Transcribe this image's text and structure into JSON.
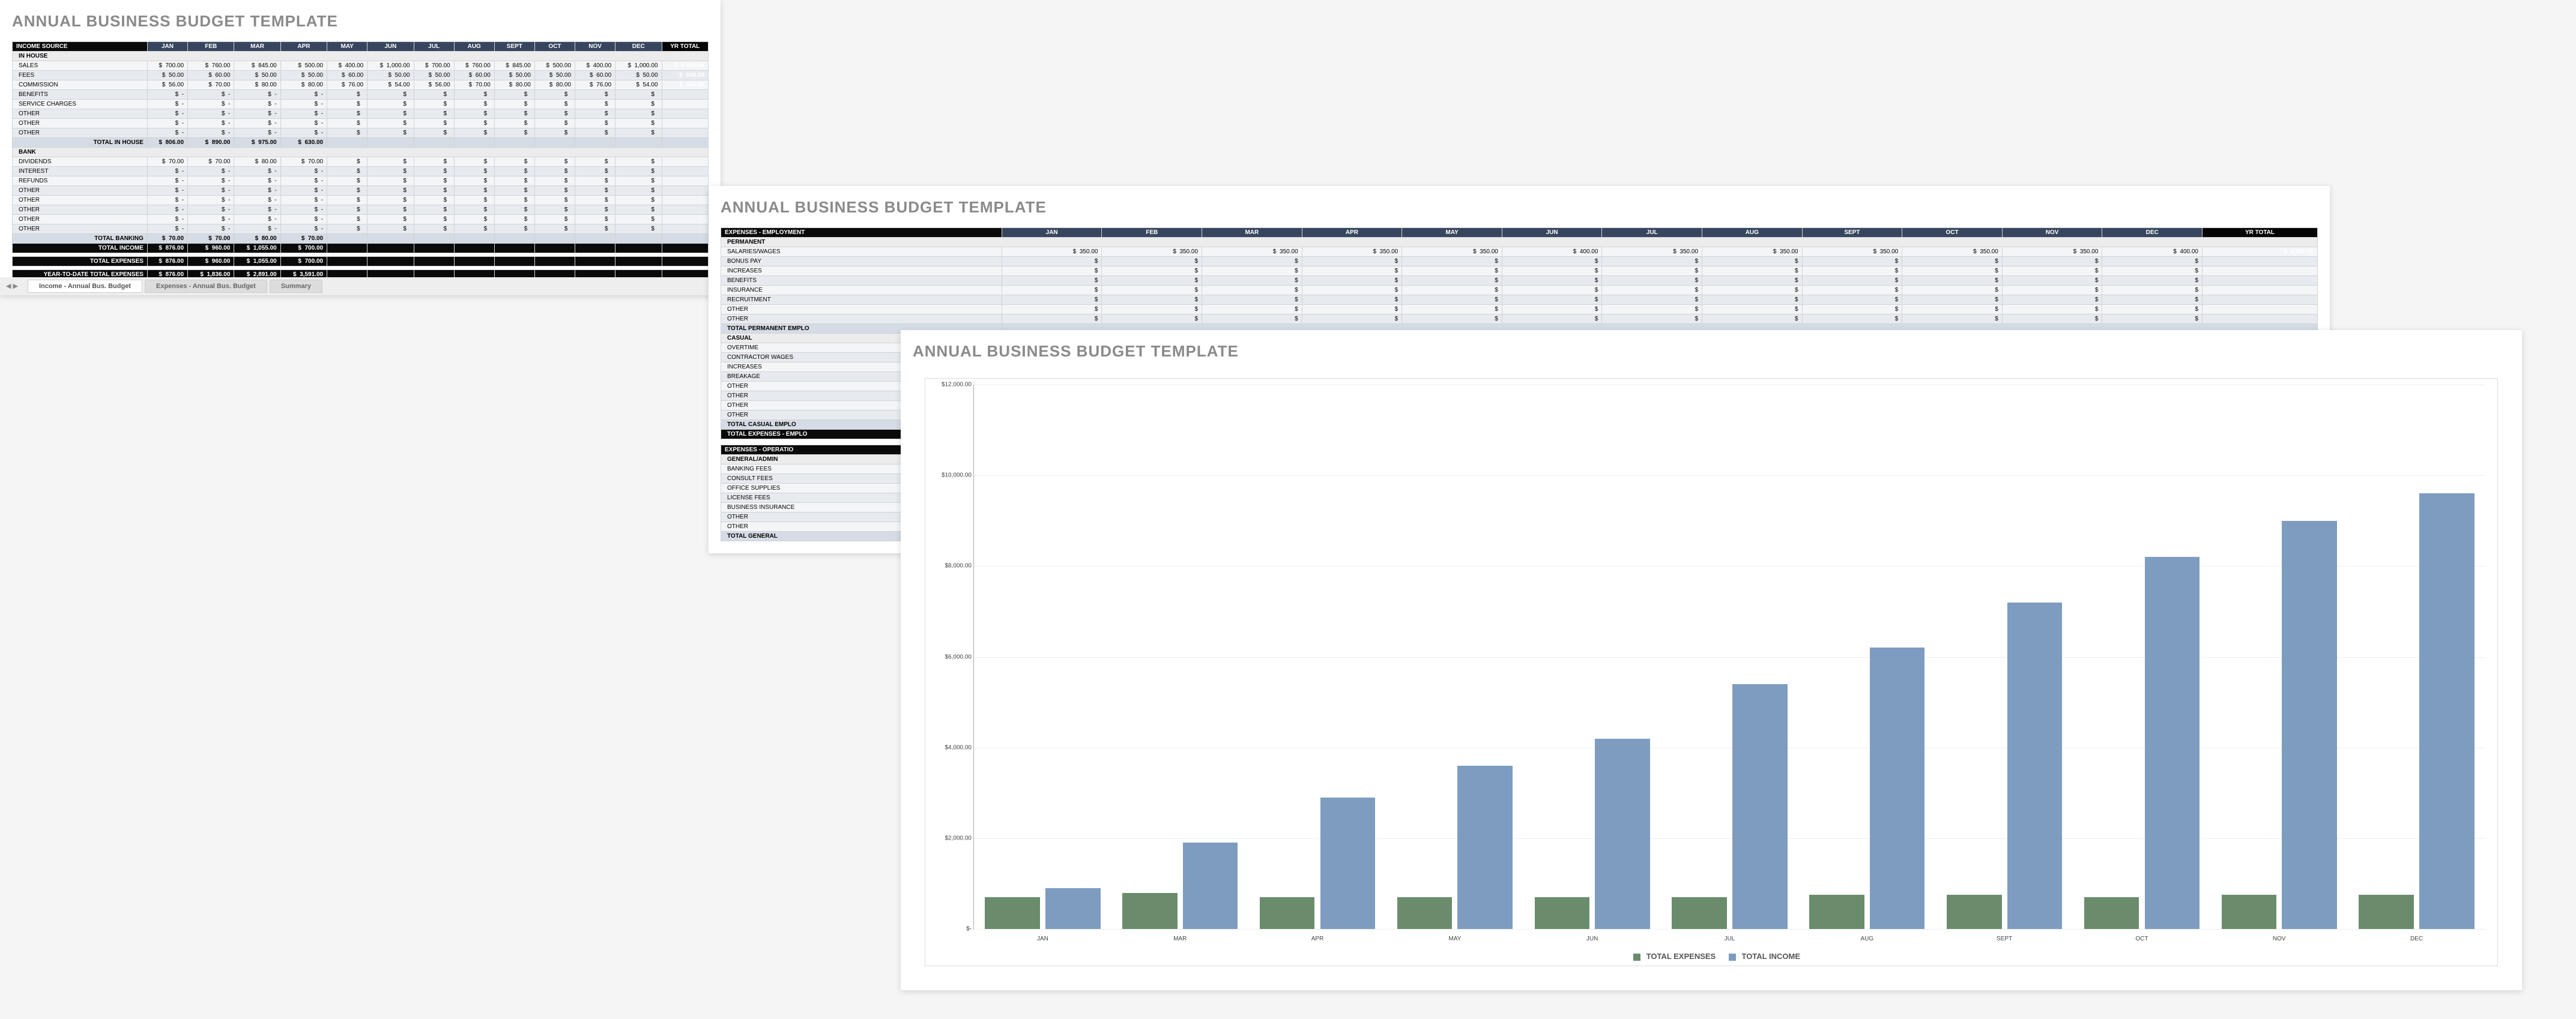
{
  "app_title": "ANNUAL BUSINESS BUDGET TEMPLATE",
  "months": [
    "JAN",
    "FEB",
    "MAR",
    "APR",
    "MAY",
    "JUN",
    "JUL",
    "AUG",
    "SEPT",
    "OCT",
    "NOV",
    "DEC"
  ],
  "yr_total_label": "YR TOTAL",
  "income_sheet": {
    "header_label": "INCOME SOURCE",
    "sections": [
      {
        "name": "IN HOUSE",
        "rows": [
          {
            "label": "SALES",
            "vals": [
              "700.00",
              "760.00",
              "845.00",
              "500.00",
              "400.00",
              "1,000.00",
              "700.00",
              "760.00",
              "845.00",
              "500.00",
              "400.00",
              "1,000.00"
            ],
            "yt": "8,410.00"
          },
          {
            "label": "FEES",
            "vals": [
              "50.00",
              "60.00",
              "50.00",
              "50.00",
              "60.00",
              "50.00",
              "50.00",
              "60.00",
              "50.00",
              "50.00",
              "60.00",
              "50.00"
            ],
            "yt": "640.00"
          },
          {
            "label": "COMMISSION",
            "vals": [
              "56.00",
              "70.00",
              "80.00",
              "80.00",
              "76.00",
              "54.00",
              "56.00",
              "70.00",
              "80.00",
              "80.00",
              "76.00",
              "54.00"
            ],
            "yt": "832.00"
          },
          {
            "label": "BENEFITS",
            "vals": [
              "-",
              "-",
              "-",
              "-"
            ],
            "yt": ""
          },
          {
            "label": "SERVICE CHARGES",
            "vals": [
              "-",
              "-",
              "-",
              "-"
            ],
            "yt": ""
          },
          {
            "label": "OTHER",
            "vals": [
              "-",
              "-",
              "-",
              "-"
            ],
            "yt": ""
          },
          {
            "label": "OTHER",
            "vals": [
              "-",
              "-",
              "-",
              "-"
            ],
            "yt": ""
          },
          {
            "label": "OTHER",
            "vals": [
              "-",
              "-",
              "-",
              "-"
            ],
            "yt": ""
          }
        ],
        "total": {
          "label": "TOTAL IN HOUSE",
          "vals": [
            "806.00",
            "890.00",
            "975.00",
            "630.00"
          ],
          "yt": ""
        }
      },
      {
        "name": "BANK",
        "rows": [
          {
            "label": "DIVIDENDS",
            "vals": [
              "70.00",
              "70.00",
              "80.00",
              "70.00"
            ],
            "yt": ""
          },
          {
            "label": "INTEREST",
            "vals": [
              "-",
              "-",
              "-",
              "-"
            ],
            "yt": ""
          },
          {
            "label": "REFUNDS",
            "vals": [
              "-",
              "-",
              "-",
              "-"
            ],
            "yt": ""
          },
          {
            "label": "OTHER",
            "vals": [
              "-",
              "-",
              "-",
              "-"
            ],
            "yt": ""
          },
          {
            "label": "OTHER",
            "vals": [
              "-",
              "-",
              "-",
              "-"
            ],
            "yt": ""
          },
          {
            "label": "OTHER",
            "vals": [
              "-",
              "-",
              "-",
              "-"
            ],
            "yt": ""
          },
          {
            "label": "OTHER",
            "vals": [
              "-",
              "-",
              "-",
              "-"
            ],
            "yt": ""
          },
          {
            "label": "OTHER",
            "vals": [
              "-",
              "-",
              "-",
              "-"
            ],
            "yt": ""
          }
        ],
        "total": {
          "label": "TOTAL BANKING",
          "vals": [
            "70.00",
            "70.00",
            "80.00",
            "70.00"
          ],
          "yt": ""
        }
      }
    ],
    "totals": [
      {
        "label": "TOTAL INCOME",
        "vals": [
          "876.00",
          "960.00",
          "1,055.00",
          "700.00"
        ]
      },
      {
        "label": "TOTAL EXPENSES",
        "vals": [
          "876.00",
          "960.00",
          "1,055.00",
          "700.00"
        ]
      },
      {
        "label": "YEAR-TO-DATE TOTAL EXPENSES",
        "vals": [
          "876.00",
          "1,836.00",
          "2,891.00",
          "3,591.00"
        ]
      }
    ]
  },
  "expenses_sheet": {
    "header_label": "EXPENSES - EMPLOYMENT",
    "permanent_label": "PERMANENT",
    "perm_rows": [
      {
        "label": "SALARIES/WAGES",
        "vals": [
          "350.00",
          "350.00",
          "350.00",
          "350.00",
          "350.00",
          "400.00",
          "350.00",
          "350.00",
          "350.00",
          "350.00",
          "350.00",
          "400.00"
        ],
        "yt": "4,300.00"
      },
      {
        "label": "BONUS PAY"
      },
      {
        "label": "INCREASES"
      },
      {
        "label": "BENEFITS"
      },
      {
        "label": "INSURANCE"
      },
      {
        "label": "RECRUITMENT"
      },
      {
        "label": "OTHER"
      },
      {
        "label": "OTHER"
      }
    ],
    "perm_total_label": "TOTAL PERMANENT EMPLO",
    "casual_label": "CASUAL",
    "casual_rows": [
      {
        "label": "OVERTIME"
      },
      {
        "label": "CONTRACTOR WAGES"
      },
      {
        "label": "INCREASES"
      },
      {
        "label": "BREAKAGE"
      },
      {
        "label": "OTHER"
      },
      {
        "label": "OTHER"
      },
      {
        "label": "OTHER"
      },
      {
        "label": "OTHER"
      }
    ],
    "casual_total_label": "TOTAL CASUAL EMPLO",
    "emp_total_label": "TOTAL EXPENSES - EMPLO",
    "ops_header": "EXPENSES - OPERATIO",
    "general_label": "GENERAL/ADMIN",
    "general_rows": [
      {
        "label": "BANKING FEES"
      },
      {
        "label": "CONSULT FEES"
      },
      {
        "label": "OFFICE SUPPLIES"
      },
      {
        "label": "LICENSE FEES"
      },
      {
        "label": "BUSINESS INSURANCE"
      },
      {
        "label": "OTHER"
      },
      {
        "label": "OTHER"
      }
    ],
    "general_total_label": "TOTAL GENERAL"
  },
  "tabs": [
    "Income - Annual Bus. Budget",
    "Expenses - Annual Bus. Budget",
    "Summary"
  ],
  "chart_data": {
    "type": "bar",
    "title": "",
    "ylabel": "",
    "xlabel": "",
    "ylim": [
      0,
      12000
    ],
    "y_ticks": [
      "$-",
      "$2,000.00",
      "$4,000.00",
      "$6,000.00",
      "$8,000.00",
      "$10,000.00",
      "$12,000.00"
    ],
    "categories": [
      "JAN",
      "MAR",
      "APR",
      "MAY",
      "JUN",
      "JUL",
      "AUG",
      "SEPT",
      "OCT",
      "NOV",
      "DEC"
    ],
    "series": [
      {
        "name": "TOTAL EXPENSES",
        "color": "#6a8c6c",
        "values": [
          700,
          800,
          700,
          700,
          700,
          700,
          750,
          750,
          700,
          750,
          750
        ]
      },
      {
        "name": "TOTAL INCOME",
        "color": "#7d9cc0",
        "values": [
          900,
          1900,
          2900,
          3600,
          4200,
          5400,
          6200,
          7200,
          8200,
          9000,
          9600
        ]
      }
    ]
  }
}
